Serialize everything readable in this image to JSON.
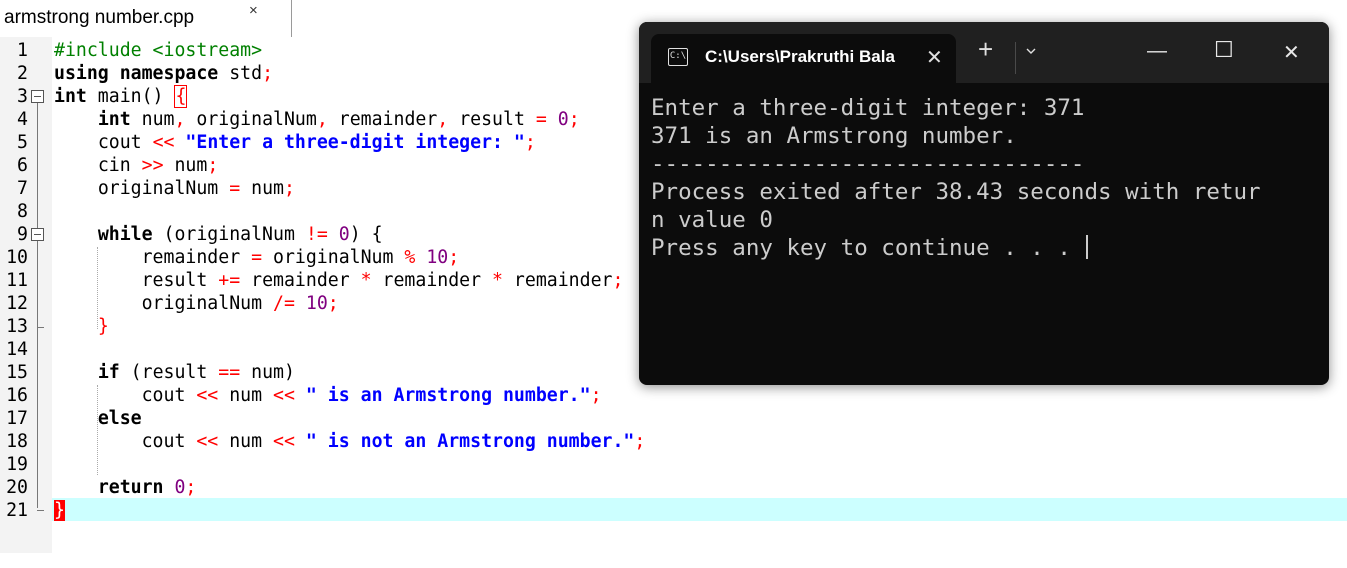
{
  "editor": {
    "tab": {
      "filename": "armstrong number.cpp",
      "close": "×"
    },
    "lines": [
      {
        "n": "1"
      },
      {
        "n": "2"
      },
      {
        "n": "3"
      },
      {
        "n": "4"
      },
      {
        "n": "5"
      },
      {
        "n": "6"
      },
      {
        "n": "7"
      },
      {
        "n": "8"
      },
      {
        "n": "9"
      },
      {
        "n": "10"
      },
      {
        "n": "11"
      },
      {
        "n": "12"
      },
      {
        "n": "13"
      },
      {
        "n": "14"
      },
      {
        "n": "15"
      },
      {
        "n": "16"
      },
      {
        "n": "17"
      },
      {
        "n": "18"
      },
      {
        "n": "19"
      },
      {
        "n": "20"
      },
      {
        "n": "21"
      }
    ],
    "code": {
      "l1_pp": "#include <iostream>",
      "l2_kw": "using namespace",
      "l2_rest": " std",
      "l3_kw": "int",
      "l3_rest": " main() ",
      "l4_kw": "int",
      "l4_rest_a": " num",
      "l4_rest_b": " originalNum",
      "l4_rest_c": " remainder",
      "l4_rest_d": " result ",
      "l4_num": "0",
      "l5_a": "cout ",
      "l5_str": "\"Enter a three-digit integer: \"",
      "l6_a": "cin ",
      "l6_b": " num",
      "l7_a": "originalNum ",
      "l7_b": " num",
      "l9_kw": "while",
      "l9_a": " (originalNum ",
      "l9_num": "0",
      "l9_b": ") {",
      "l10_a": "remainder ",
      "l10_b": " originalNum ",
      "l10_num": "10",
      "l11_a": "result ",
      "l11_b": " remainder ",
      "l11_c": " remainder ",
      "l11_d": " remainder",
      "l12_a": "originalNum ",
      "l12_num": "10",
      "l13": "}",
      "l15_kw": "if",
      "l15_a": " (result ",
      "l15_b": " num)",
      "l16_a": "cout ",
      "l16_b": " num ",
      "l16_str": "\" is an Armstrong number.\"",
      "l17_kw": "else",
      "l18_a": "cout ",
      "l18_b": " num ",
      "l18_str": "\" is not an Armstrong number.\"",
      "l20_kw": "return",
      "l20_num": "0",
      "l21": "}"
    },
    "ops": {
      "lt2": "<<",
      "gt2": ">>",
      "eq": "=",
      "neq": "!=",
      "peq": "+=",
      "mul": "*",
      "mod": "%",
      "deq": "/=",
      "eqeq": "==",
      "semi": ";",
      "comma": ",",
      "brace": "{"
    }
  },
  "terminal": {
    "tab_title": "C:\\Users\\Prakruthi Bala",
    "tab_icon": "C:\\",
    "close": "✕",
    "new_tab": "+",
    "minimize": "—",
    "maximize": "☐",
    "window_close": "✕",
    "output": [
      "Enter a three-digit integer: 371",
      "371 is an Armstrong number.",
      "--------------------------------",
      "Process exited after 38.43 seconds with retur",
      "n value 0",
      "Press any key to continue . . . "
    ]
  }
}
